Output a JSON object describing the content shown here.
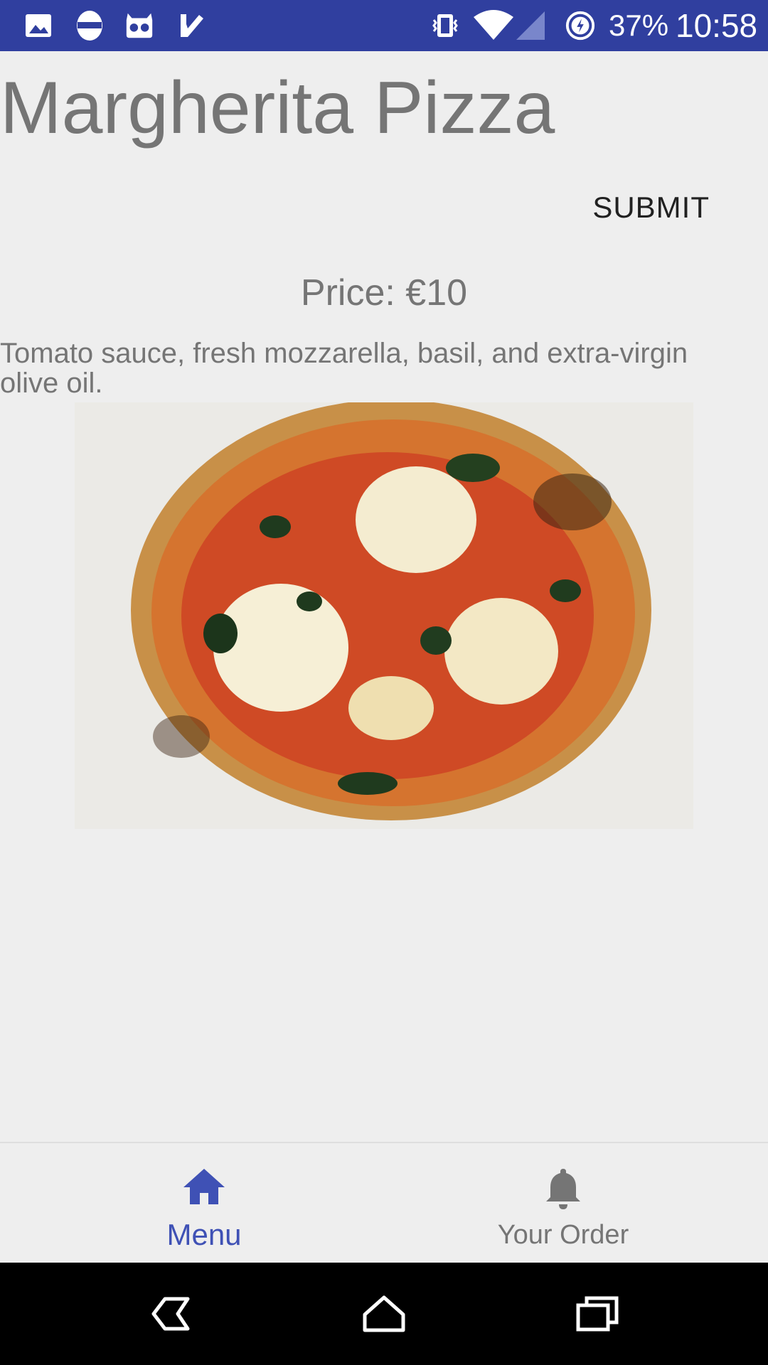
{
  "status_bar": {
    "battery": "37%",
    "time": "10:58",
    "icons": [
      "image-icon",
      "mask-icon",
      "cyanogen-icon",
      "task-check-icon",
      "vibrate-icon",
      "wifi-icon",
      "signal-icon",
      "battery-saver-icon"
    ]
  },
  "product": {
    "title": "Margherita Pizza",
    "submit_label": "SUBMIT",
    "price": "Price: €10",
    "description": "Tomato sauce, fresh mozzarella, basil, and extra-virgin olive oil.",
    "image_icon": "pizza-photo"
  },
  "bottom_nav": {
    "items": [
      {
        "label": "Menu",
        "icon": "home-icon",
        "active": true
      },
      {
        "label": "Your Order",
        "icon": "bell-icon",
        "active": false
      }
    ]
  },
  "system_nav": {
    "icons": [
      "back-icon",
      "home-outline-icon",
      "recents-icon"
    ]
  },
  "colors": {
    "status_bar": "#303f9f",
    "accent": "#3f51b5",
    "text_gray": "#757575",
    "background": "#eeeeee"
  }
}
